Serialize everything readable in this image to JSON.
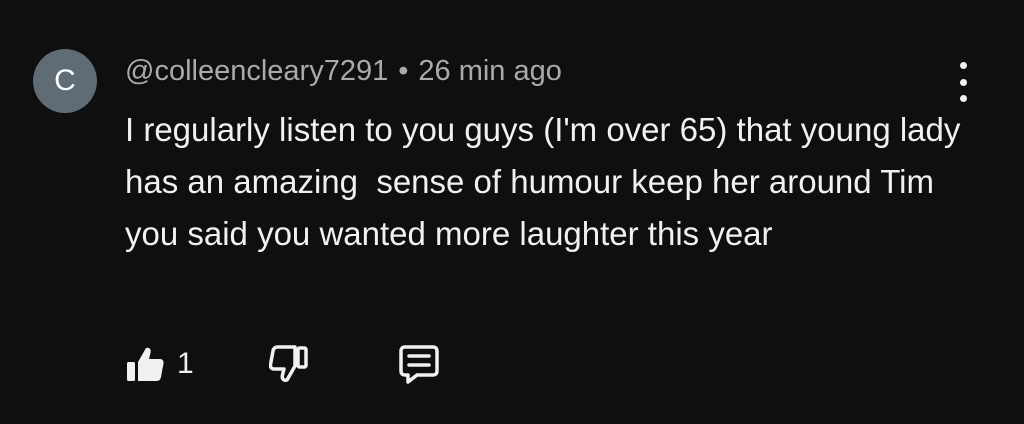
{
  "comment": {
    "avatar_letter": "C",
    "author": "@colleencleary7291",
    "separator": "•",
    "time": "26 min ago",
    "text": "I regularly listen to you guys (I'm over 65) that young lady has an amazing  sense of humour keep her around Tim you said you wanted more laughter this year",
    "like_count": "1"
  },
  "icons": {
    "like": "thumbs-up-icon",
    "dislike": "thumbs-down-icon",
    "reply": "comment-reply-icon",
    "more": "more-vertical-icon"
  },
  "colors": {
    "background": "#0f0f0f",
    "primary_text": "#f1f1f1",
    "secondary_text": "#aaaaaa",
    "avatar_bg": "#5f6b75"
  }
}
